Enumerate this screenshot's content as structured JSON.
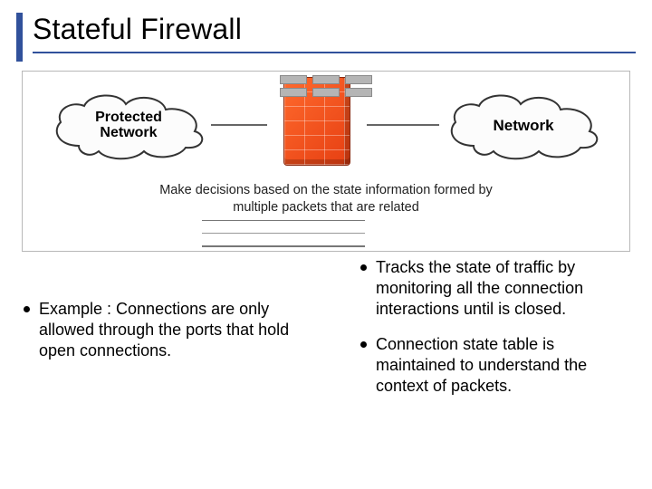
{
  "title": "Stateful Firewall",
  "diagram": {
    "left_cloud": "Protected\nNetwork",
    "right_cloud": "Network",
    "caption_line1": "Make decisions based on the state information formed by",
    "caption_line2": "multiple packets that are related"
  },
  "left_bullets": [
    "Example : Connections are only allowed through the ports that hold open connections."
  ],
  "right_bullets": [
    "Tracks the state of traffic by monitoring all the connection interactions until is closed.",
    "Connection state table is maintained to understand the context of packets."
  ]
}
